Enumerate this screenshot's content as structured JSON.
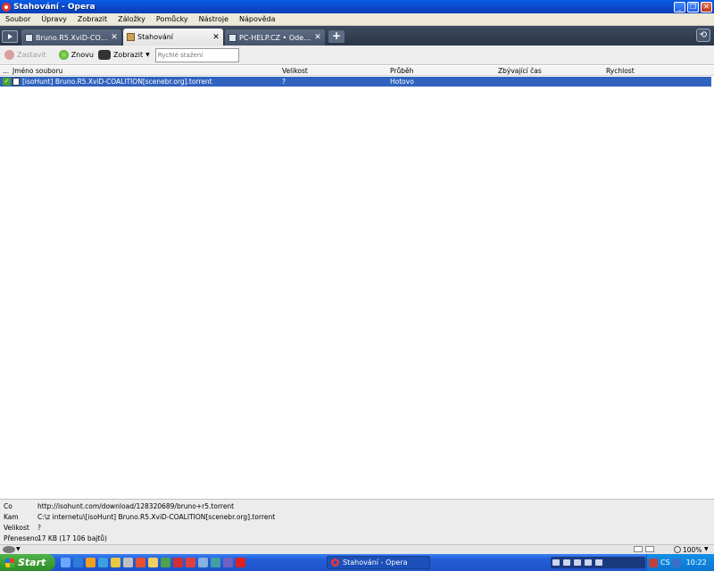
{
  "window": {
    "title": "Stahování - Opera"
  },
  "menu": [
    "Soubor",
    "Úpravy",
    "Zobrazit",
    "Záložky",
    "Pomůcky",
    "Nástroje",
    "Nápověda"
  ],
  "tabs": [
    {
      "label": "Bruno.R5.XviD-COALITION...",
      "icon": "page-icon",
      "active": false
    },
    {
      "label": "Stahování",
      "icon": "downloads-icon",
      "active": true
    },
    {
      "label": "PC-HELP.CZ • Odeslat o...",
      "icon": "page-icon",
      "active": false
    }
  ],
  "toolbar": {
    "stop_label": "Zastavit",
    "retry_label": "Znovu",
    "view_label": "Zobrazit",
    "quick_placeholder": "Rychlé stažení"
  },
  "table": {
    "columns": [
      "...",
      "Jméno souboru",
      "Velikost",
      "Průběh",
      "Zbývající čas",
      "Rychlost"
    ],
    "rows": [
      {
        "name": "[isoHunt] Bruno.R5.XviD-COALITION[scenebr.org].torrent",
        "size": "?",
        "progress": "Hotovo",
        "remaining": "",
        "speed": ""
      }
    ]
  },
  "details": [
    {
      "key": "Co",
      "value": "http://isohunt.com/download/128320689/bruno+r5.torrent"
    },
    {
      "key": "Kam",
      "value": "C:\\z internetu\\[isoHunt] Bruno.R5.XviD-COALITION[scenebr.org].torrent"
    },
    {
      "key": "Velikost",
      "value": "?"
    },
    {
      "key": "Přeneseno",
      "value": "17 KB (17 106 bajtů)"
    }
  ],
  "status": {
    "zoom": "100%"
  },
  "taskbar": {
    "start_label": "Start",
    "active_window": "Stahování - Opera",
    "clock": "10:22",
    "tray_lang": "CS"
  },
  "colors": {
    "titlebar": "#0a56d8",
    "selection": "#3062bf",
    "taskbar": "#245edb",
    "start": "#3a9a33"
  }
}
